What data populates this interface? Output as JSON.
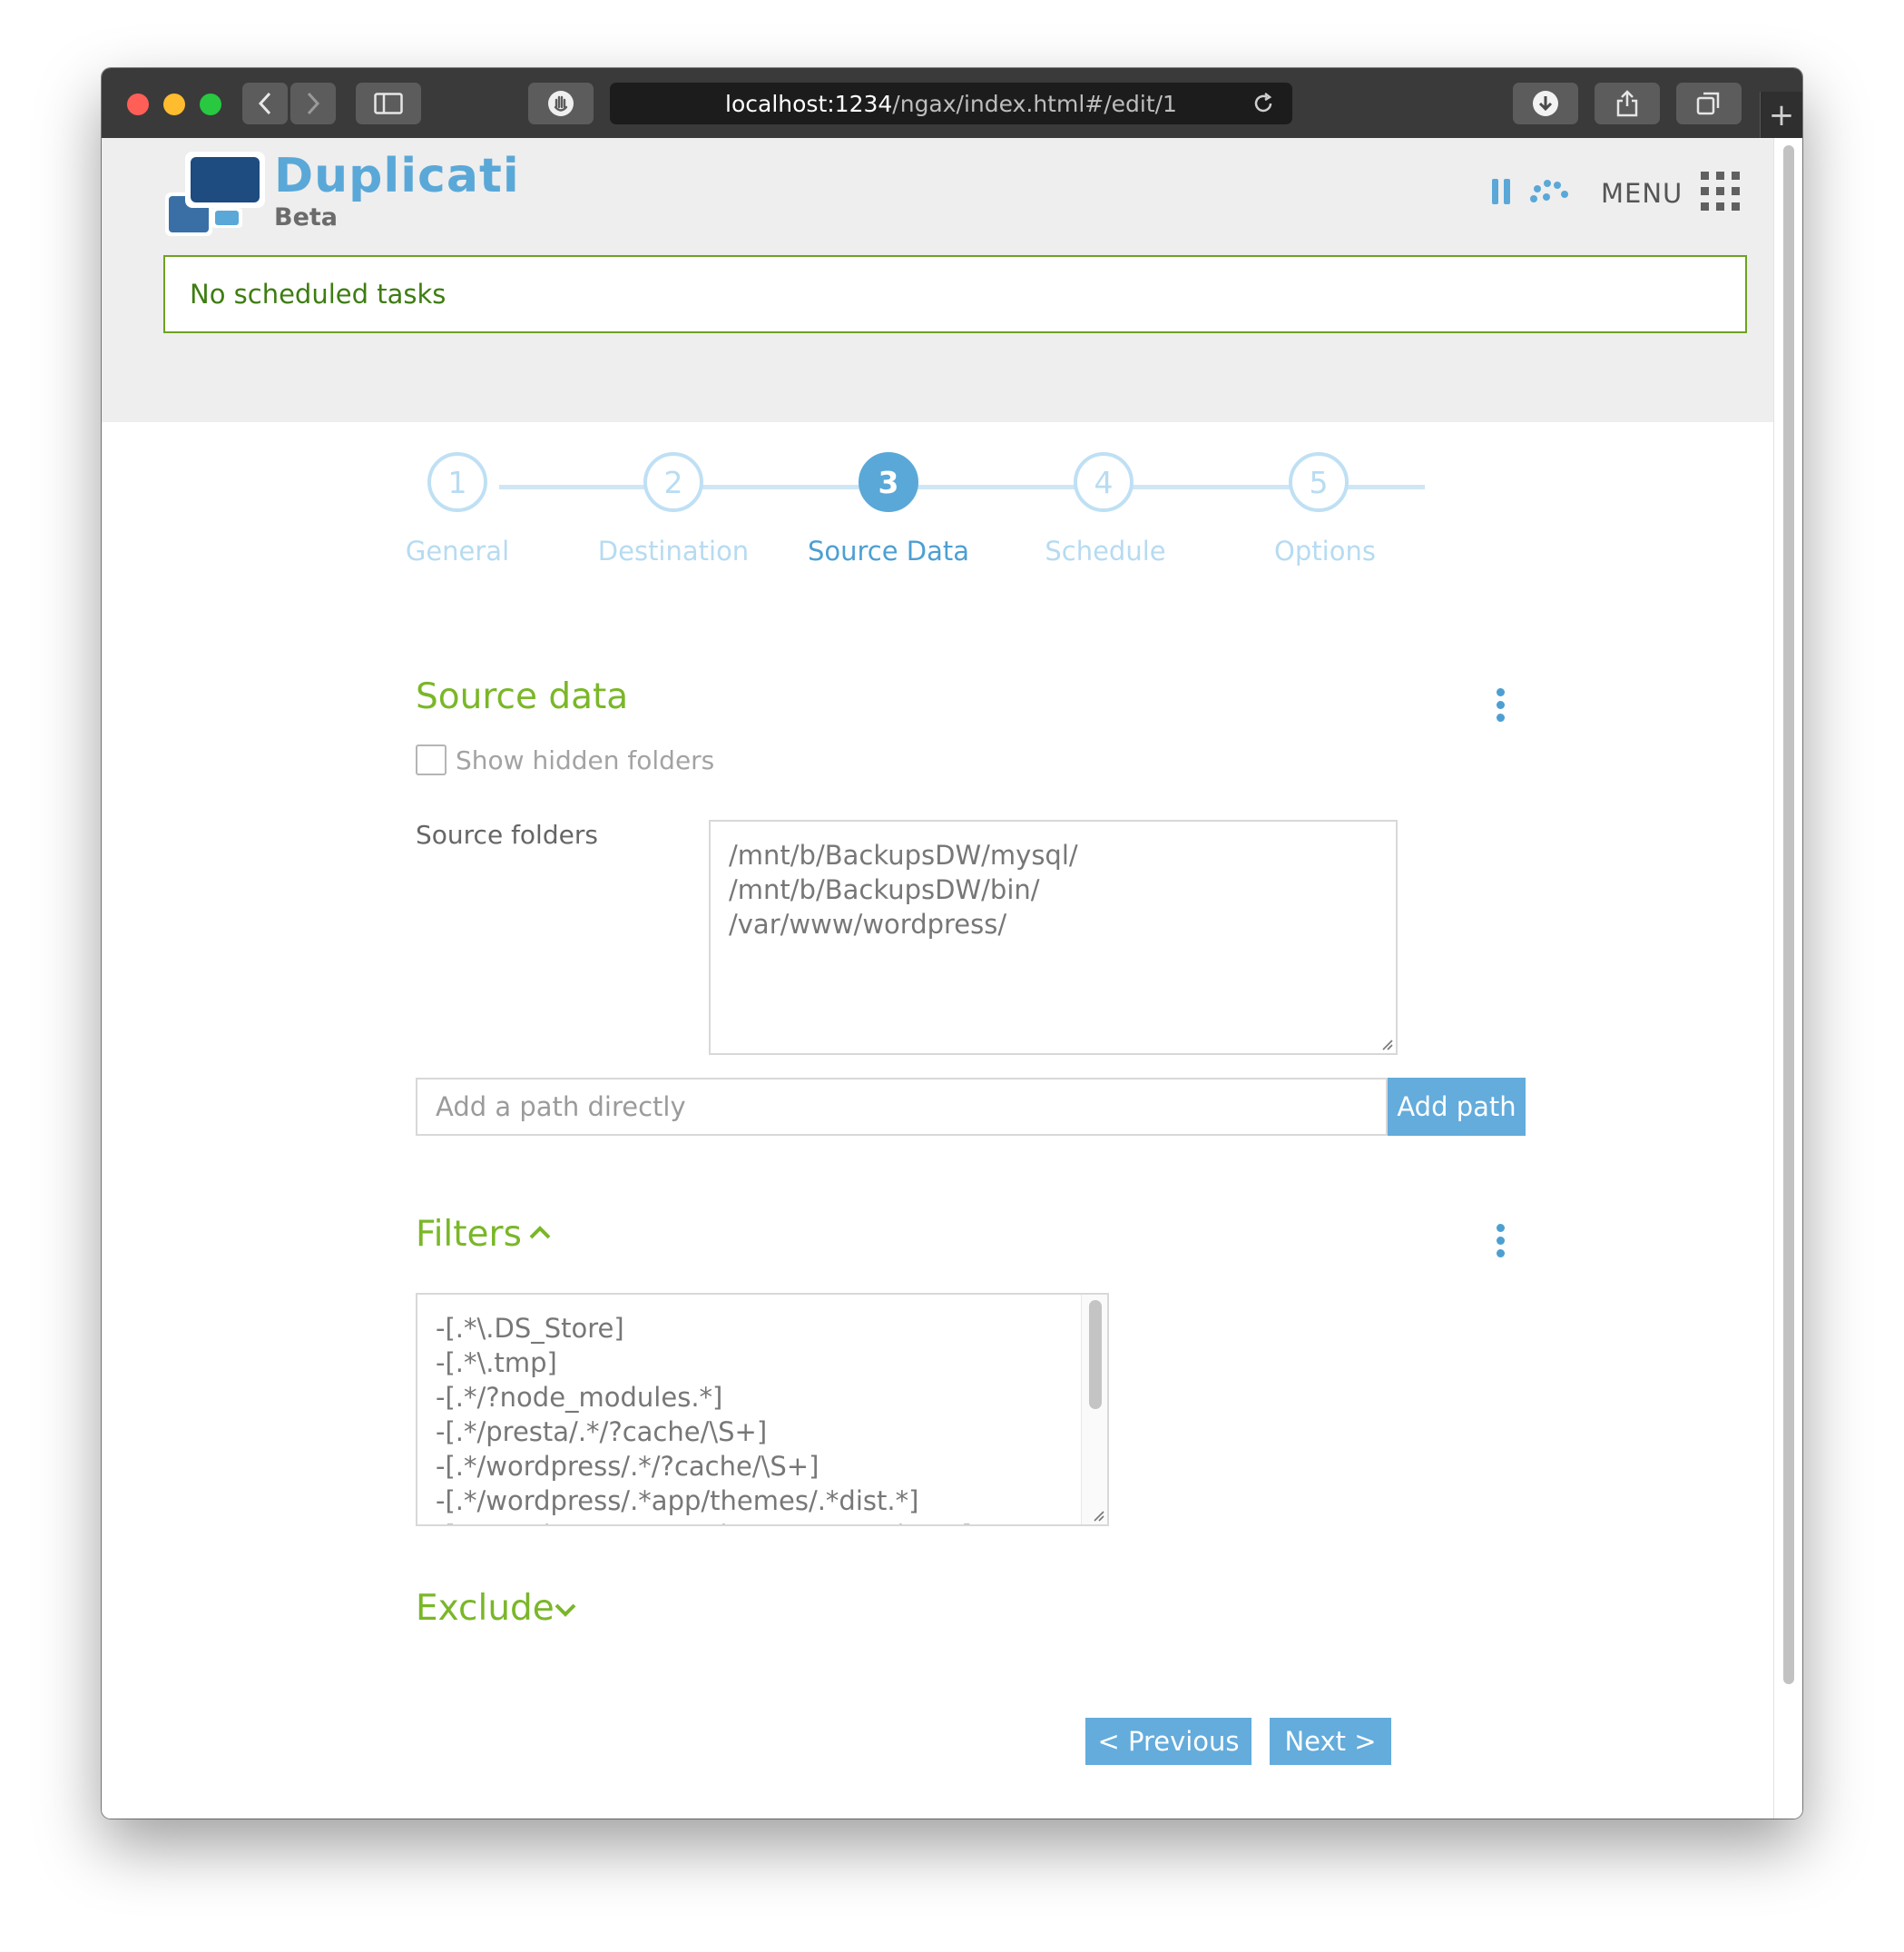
{
  "browser": {
    "url_host": "localhost:1234",
    "url_path": "/ngax/index.html#/edit/1",
    "new_tab_label": "+"
  },
  "header": {
    "brand": "Duplicati",
    "subtitle": "Beta",
    "menu_label": "MENU",
    "notice": "No scheduled tasks"
  },
  "wizard": {
    "steps": [
      {
        "number": "1",
        "label": "General"
      },
      {
        "number": "2",
        "label": "Destination"
      },
      {
        "number": "3",
        "label": "Source Data",
        "active": true
      },
      {
        "number": "4",
        "label": "Schedule"
      },
      {
        "number": "5",
        "label": "Options"
      }
    ]
  },
  "source": {
    "title": "Source data",
    "show_hidden_label": "Show hidden folders",
    "show_hidden_checked": false,
    "folders_label": "Source folders",
    "folders": [
      "/mnt/b/BackupsDW/mysql/",
      "/mnt/b/BackupsDW/bin/",
      "/var/www/wordpress/"
    ],
    "add_path_placeholder": "Add a path directly",
    "add_path_button": "Add path"
  },
  "filters": {
    "title": "Filters",
    "lines": [
      "-[.*\\.DS_Store]",
      "-[.*\\.tmp]",
      "-[.*/?node_modules.*]",
      "-[.*/presta/.*/?cache/\\S+]",
      "-[.*/wordpress/.*/?cache/\\S+]",
      "-[.*/wordpress/.*app/themes/.*dist.*]",
      "-[.*/wordpress/.*app/themes/.*vendor/.*]"
    ]
  },
  "exclude": {
    "title": "Exclude"
  },
  "nav": {
    "previous": "< Previous",
    "next": "Next >"
  },
  "colors": {
    "accent_blue": "#5aa8d8",
    "section_green": "#7ab728",
    "notice_green": "#3e7d12"
  }
}
